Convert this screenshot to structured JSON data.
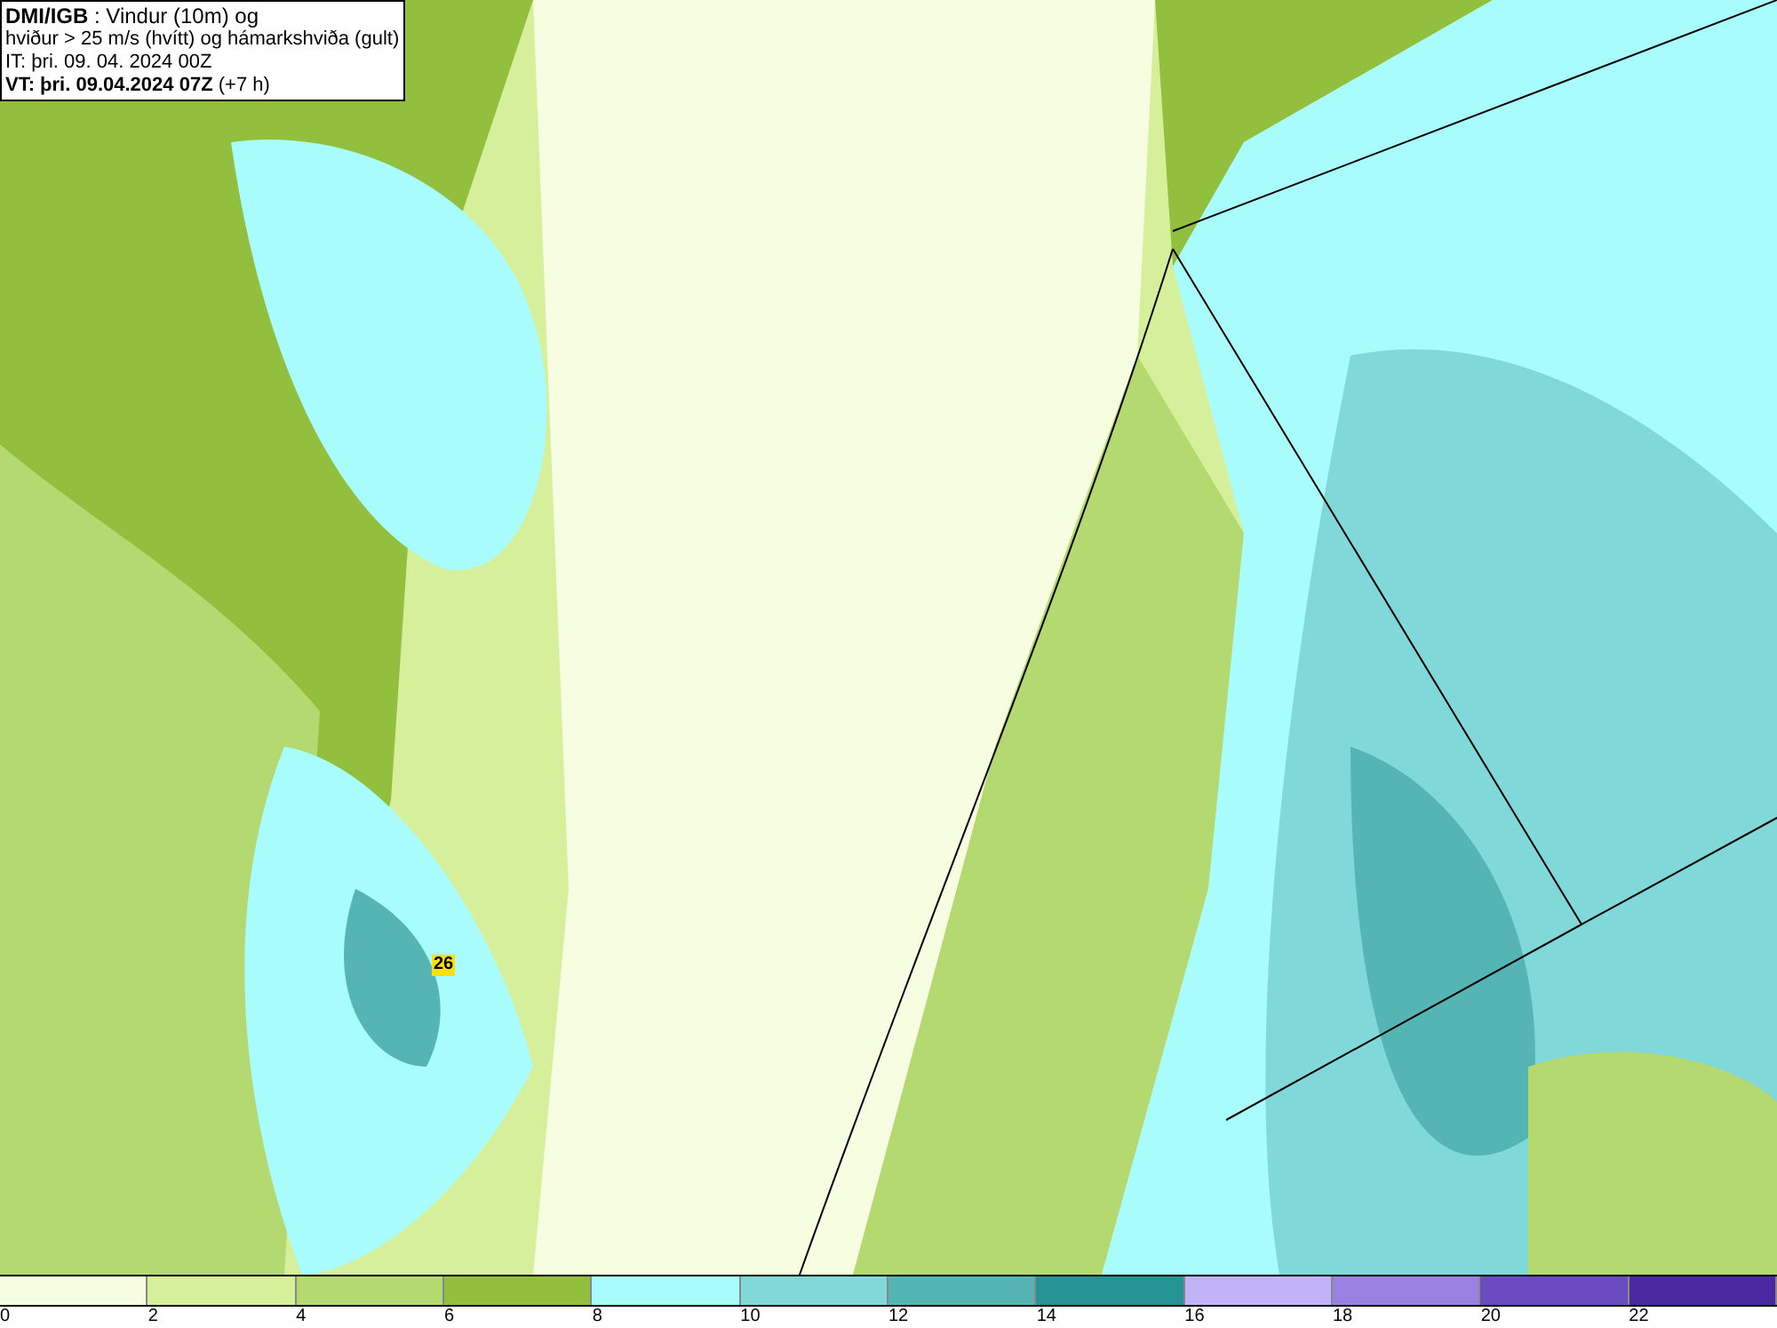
{
  "info_box": {
    "lines": [
      "**DMI/IGB** : Vindur (10m) og",
      "hviður > 25 m/s (hvítt) og hámarkshviða (gult)",
      "IT: þri. 09. 04. 2024 00Z",
      "**VT: þri. 09.04.2024 07Z** (+7 h)"
    ]
  },
  "map": {
    "gust_marker": {
      "value": "26"
    }
  },
  "legend": {
    "bins": [
      {
        "label": "0",
        "color": "#f7fde0"
      },
      {
        "label": "2",
        "color": "#d6ef9b"
      },
      {
        "label": "4",
        "color": "#b4d970"
      },
      {
        "label": "6",
        "color": "#93bf3f"
      },
      {
        "label": "8",
        "color": "#a8fcfc"
      },
      {
        "label": "10",
        "color": "#80d8d8"
      },
      {
        "label": "12",
        "color": "#55b5b5"
      },
      {
        "label": "14",
        "color": "#269494"
      },
      {
        "label": "16",
        "color": "#c2b2f8"
      },
      {
        "label": "18",
        "color": "#9a80e0"
      },
      {
        "label": "20",
        "color": "#6b4bc0"
      },
      {
        "label": "22",
        "color": "#4a2aa0"
      }
    ]
  }
}
